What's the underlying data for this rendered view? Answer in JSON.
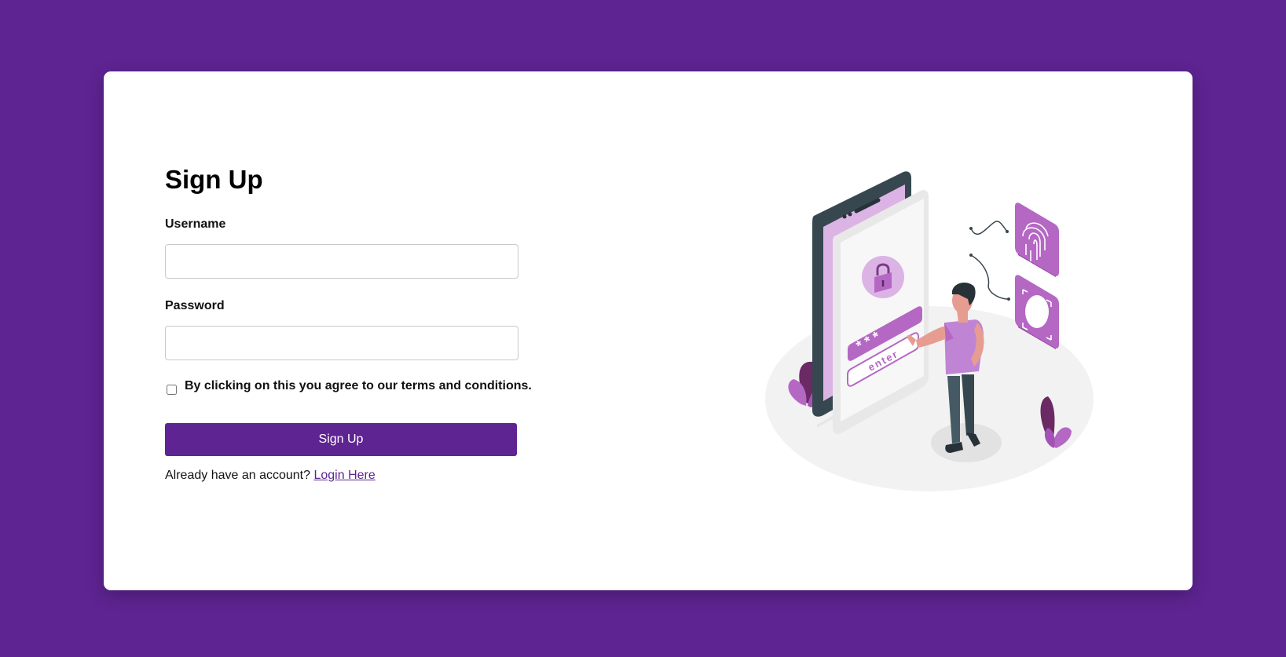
{
  "signup": {
    "title": "Sign Up",
    "username_label": "Username",
    "username_value": "",
    "password_label": "Password",
    "password_value": "",
    "terms_text": "By clicking on this you agree to our terms and conditions.",
    "terms_checked": false,
    "submit_label": "Sign Up",
    "login_prompt": "Already have an account?",
    "login_link": "Login Here"
  },
  "illustration": {
    "enter_text": "enter",
    "password_mask": "* * *",
    "icons": [
      "padlock-icon",
      "fingerprint-icon",
      "face-id-icon"
    ]
  },
  "colors": {
    "background": "#5e2492",
    "accent": "#5e2492",
    "illustration_purple": "#b567c4",
    "illustration_light": "#dcb3e5"
  }
}
